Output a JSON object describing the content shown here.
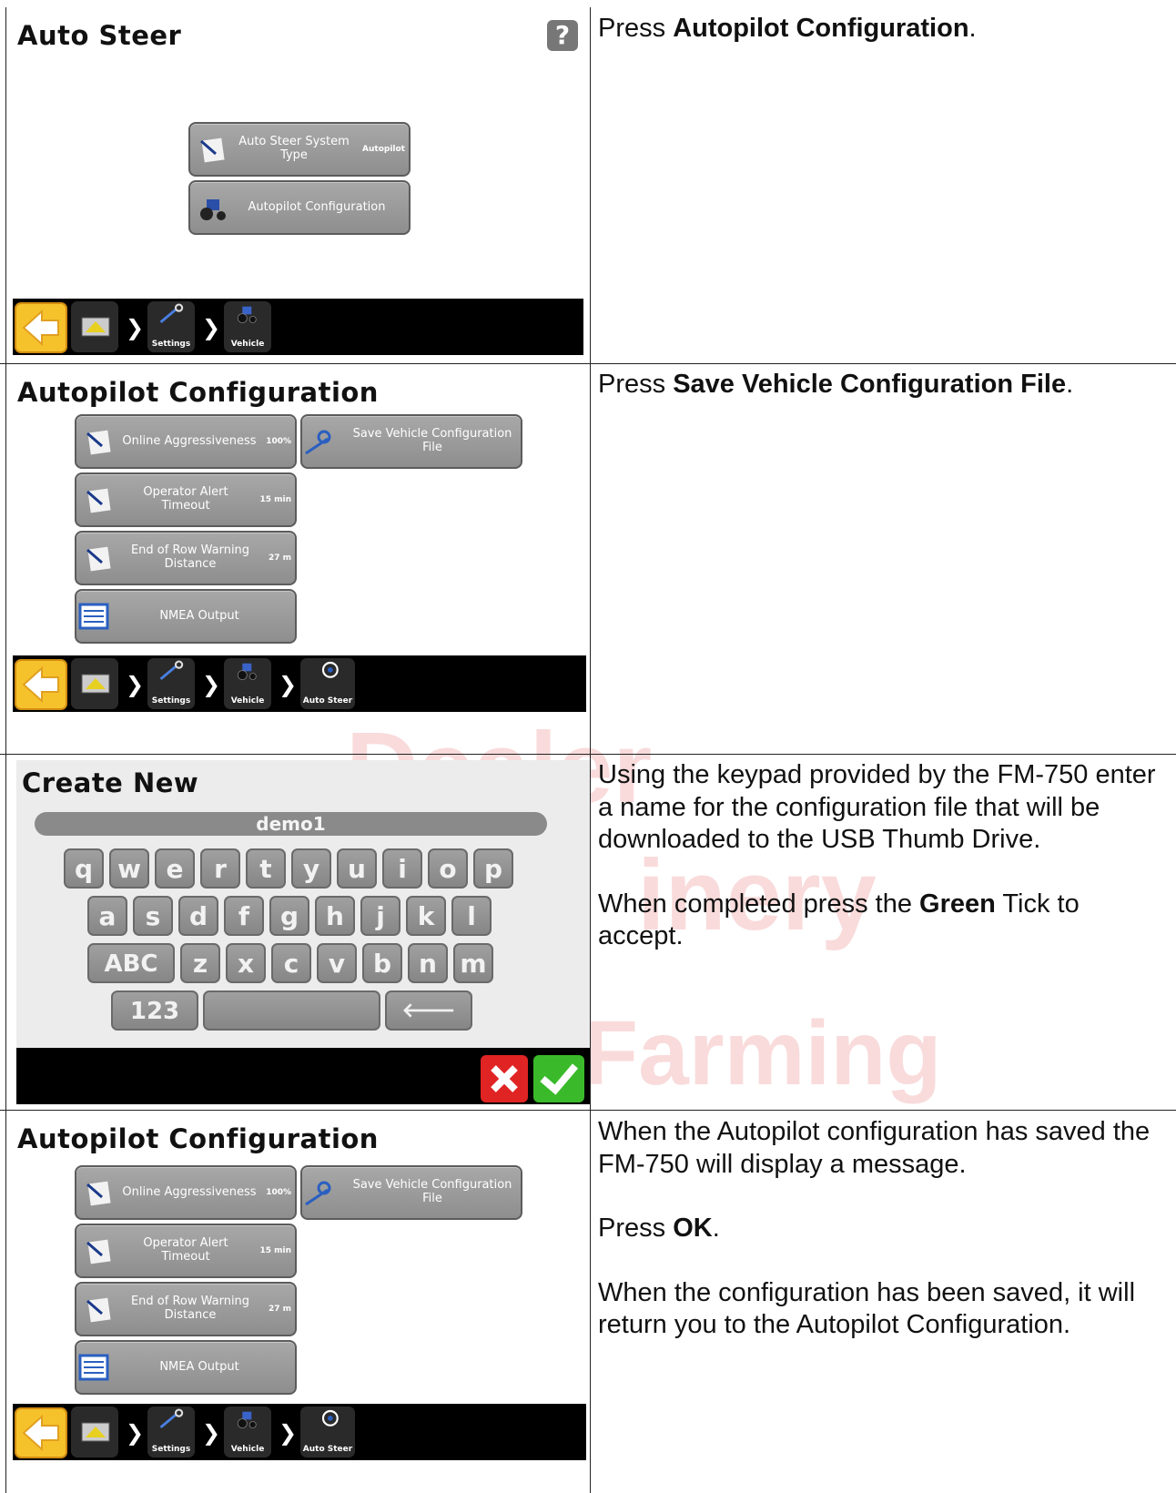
{
  "colors": {
    "accent_back": "#f6c22c",
    "cancel": "#e02424",
    "accept": "#3aba2a",
    "button": "#9a9a9a"
  },
  "rows": [
    {
      "screen": {
        "title": "Auto Steer",
        "help_label": "?",
        "buttons": [
          {
            "label": "Auto Steer System Type",
            "value": "Autopilot",
            "icon": "wrench-document-icon"
          },
          {
            "label": "Autopilot Configuration",
            "icon": "tractor-icon"
          }
        ],
        "nav": [
          "Settings",
          "Vehicle"
        ]
      },
      "text": "Press <b>Autopilot Configuration</b>."
    },
    {
      "screen": {
        "title": "Autopilot Configuration",
        "buttons": [
          {
            "label": "Online Aggressiveness",
            "value": "100%"
          },
          {
            "label": "Save Vehicle Configuration File"
          },
          {
            "label": "Operator Alert Timeout",
            "value": "15 min"
          },
          {
            "label": "End of Row Warning Distance",
            "value": "27 m"
          },
          {
            "label": "NMEA Output"
          }
        ],
        "nav": [
          "Settings",
          "Vehicle",
          "Auto Steer"
        ]
      },
      "text": "Press <b>Save Vehicle Configuration File</b>."
    },
    {
      "screen": {
        "title": "Create New",
        "field_value": "demo1",
        "keys_row1": [
          "q",
          "w",
          "e",
          "r",
          "t",
          "y",
          "u",
          "i",
          "o",
          "p"
        ],
        "keys_row2": [
          "a",
          "s",
          "d",
          "f",
          "g",
          "h",
          "j",
          "k",
          "l"
        ],
        "keys_row3": [
          "ABC",
          "z",
          "x",
          "c",
          "v",
          "b",
          "n",
          "m"
        ],
        "key_123": "123",
        "key_backspace": "🡐"
      },
      "text_p1": "Using the keypad provided by the FM-750 enter a name for the configuration file that will be downloaded to the USB Thumb Drive.",
      "text_p2_a": "When completed press the ",
      "text_p2_b": "Green",
      "text_p2_c": " Tick to accept."
    },
    {
      "screen": {
        "title": "Autopilot Configuration",
        "buttons": [
          {
            "label": "Online Aggressiveness",
            "value": "100%"
          },
          {
            "label": "Save Vehicle Configuration File"
          },
          {
            "label": "Operator Alert Timeout",
            "value": "15 min"
          },
          {
            "label": "End of Row Warning Distance",
            "value": "27 m"
          },
          {
            "label": "NMEA Output"
          }
        ],
        "nav": [
          "Settings",
          "Vehicle",
          "Auto Steer"
        ]
      },
      "text_p1": "When the Autopilot configuration has saved the FM-750 will display a message.",
      "text_p2_a": "Press ",
      "text_p2_b": "OK",
      "text_p2_c": ".",
      "text_p3": "When the configuration has been saved, it will return you to the Autopilot Configuration."
    }
  ]
}
